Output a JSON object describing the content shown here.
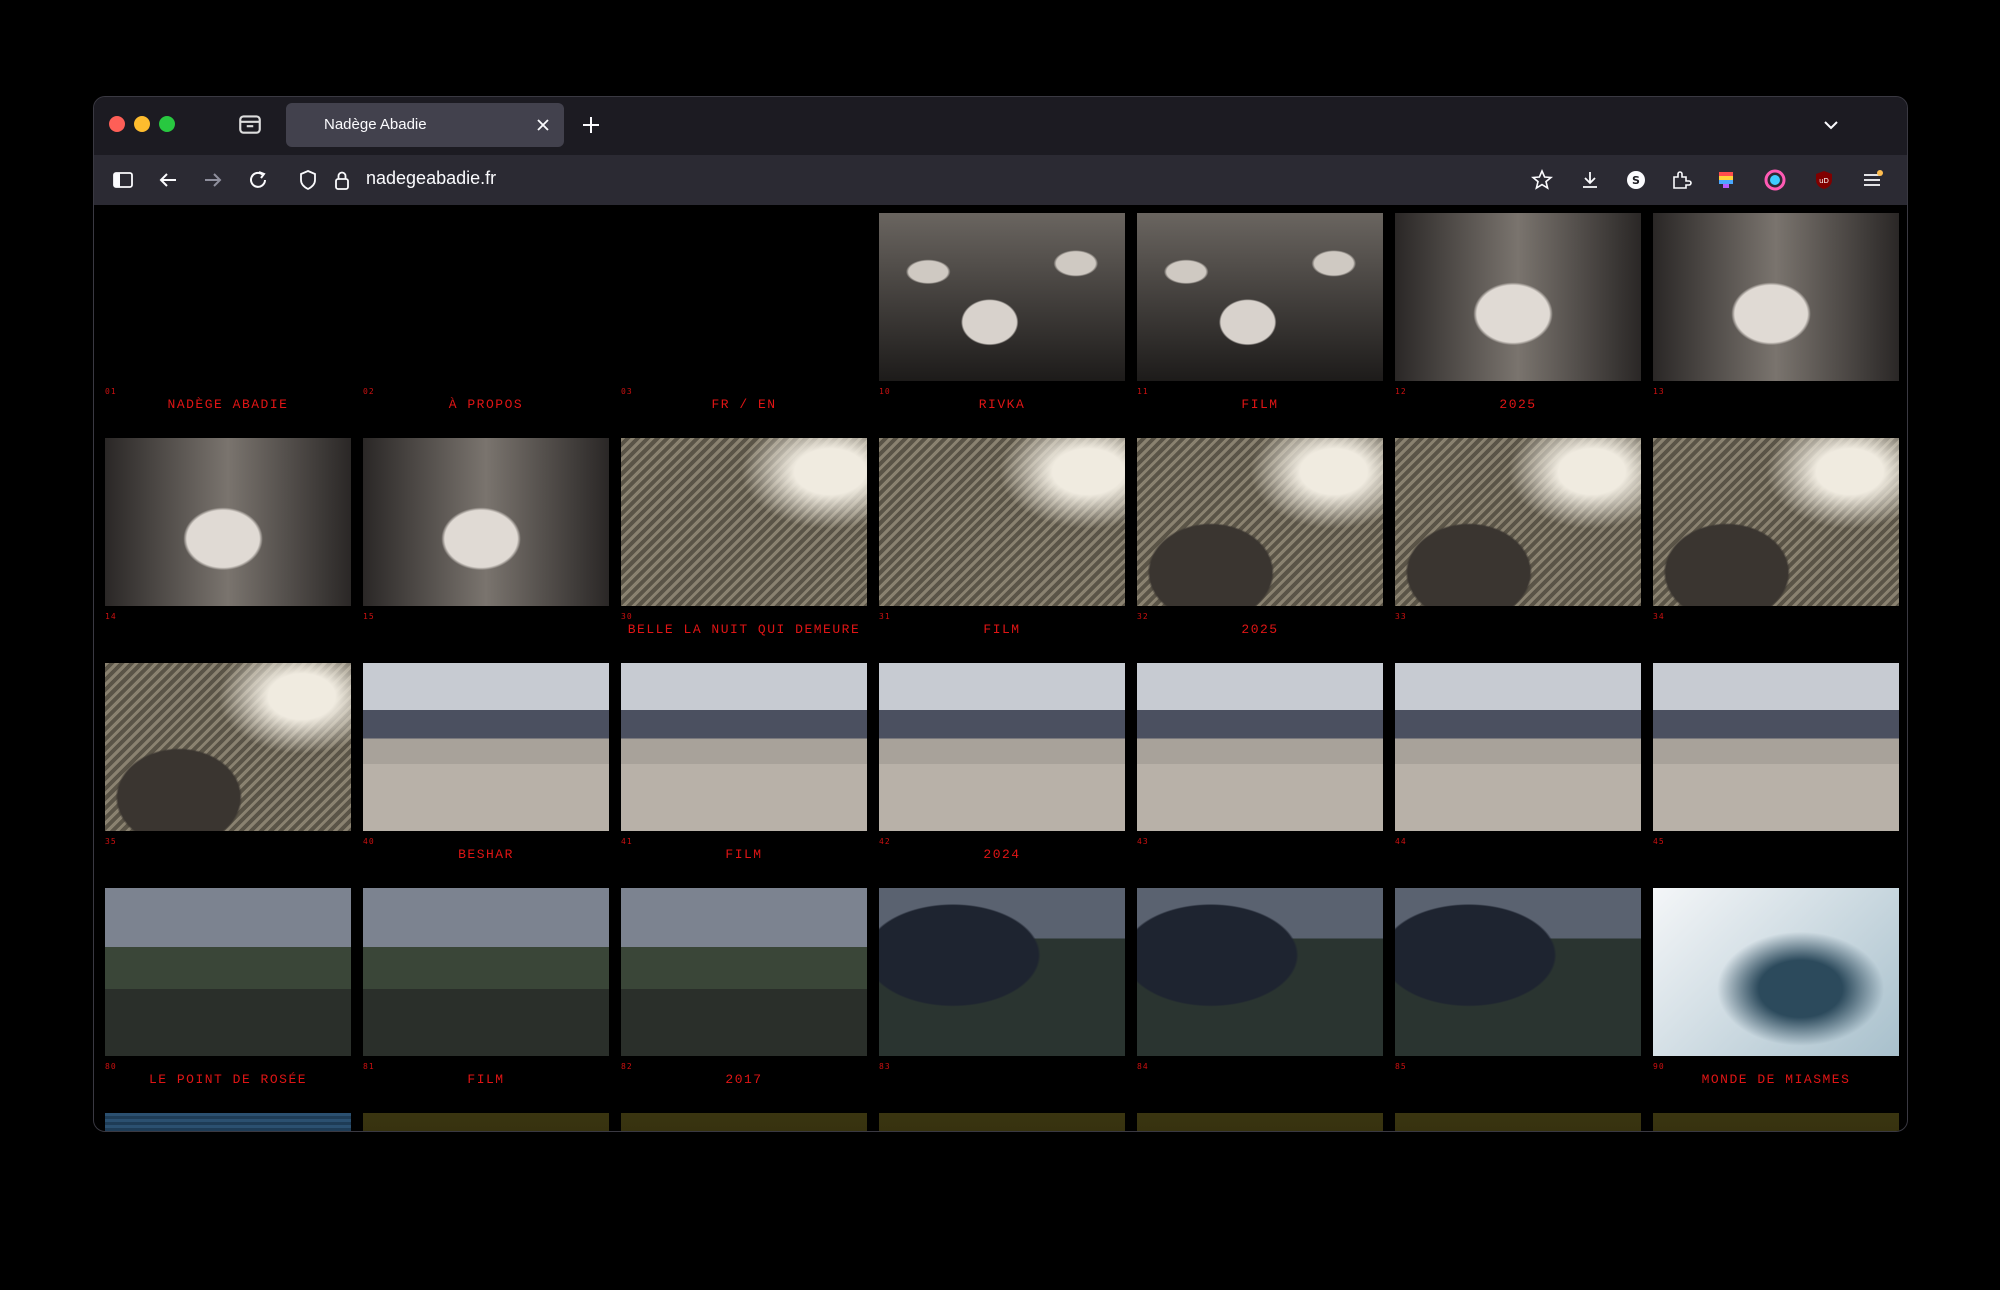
{
  "browser": {
    "tab_title": "Nadège Abadie",
    "url": "nadegeabadie.fr"
  },
  "grid": [
    [
      {
        "num": "01",
        "label": "NADÈGE ABADIE",
        "image": "none"
      },
      {
        "num": "02",
        "label": "À PROPOS",
        "image": "none"
      },
      {
        "num": "03",
        "label": "FR / EN",
        "image": "none"
      },
      {
        "num": "10",
        "label": "RIVKA",
        "image": "photo1"
      },
      {
        "num": "11",
        "label": "FILM",
        "image": "photo1"
      },
      {
        "num": "12",
        "label": "2025",
        "image": "photo2"
      },
      {
        "num": "13",
        "label": "",
        "image": "photo2"
      }
    ],
    [
      {
        "num": "14",
        "label": "",
        "image": "photo2"
      },
      {
        "num": "15",
        "label": "",
        "image": "photo2"
      },
      {
        "num": "30",
        "label": "BELLE LA NUIT QUI DEMEURE",
        "image": "tree"
      },
      {
        "num": "31",
        "label": "FILM",
        "image": "tree"
      },
      {
        "num": "32",
        "label": "2025",
        "image": "tree2"
      },
      {
        "num": "33",
        "label": "",
        "image": "tree2"
      },
      {
        "num": "34",
        "label": "",
        "image": "tree2"
      }
    ],
    [
      {
        "num": "35",
        "label": "",
        "image": "tree2"
      },
      {
        "num": "40",
        "label": "BESHAR",
        "image": "lake"
      },
      {
        "num": "41",
        "label": "FILM",
        "image": "lake"
      },
      {
        "num": "42",
        "label": "2024",
        "image": "lake"
      },
      {
        "num": "43",
        "label": "",
        "image": "lake"
      },
      {
        "num": "44",
        "label": "",
        "image": "lake"
      },
      {
        "num": "45",
        "label": "",
        "image": "lake"
      }
    ],
    [
      {
        "num": "80",
        "label": "LE POINT DE ROSÉE",
        "image": "field"
      },
      {
        "num": "81",
        "label": "FILM",
        "image": "field"
      },
      {
        "num": "82",
        "label": "2017",
        "image": "field"
      },
      {
        "num": "83",
        "label": "",
        "image": "dark"
      },
      {
        "num": "84",
        "label": "",
        "image": "dark"
      },
      {
        "num": "85",
        "label": "",
        "image": "dark"
      },
      {
        "num": "90",
        "label": "MONDE DE MIASMES",
        "image": "pale"
      }
    ],
    [
      {
        "num": "",
        "label": "",
        "image": "blue"
      },
      {
        "num": "",
        "label": "",
        "image": "olive"
      },
      {
        "num": "",
        "label": "",
        "image": "olive"
      },
      {
        "num": "",
        "label": "",
        "image": "olive"
      },
      {
        "num": "",
        "label": "",
        "image": "olive"
      },
      {
        "num": "",
        "label": "",
        "image": "olive"
      },
      {
        "num": "",
        "label": "",
        "image": "olive"
      }
    ]
  ]
}
